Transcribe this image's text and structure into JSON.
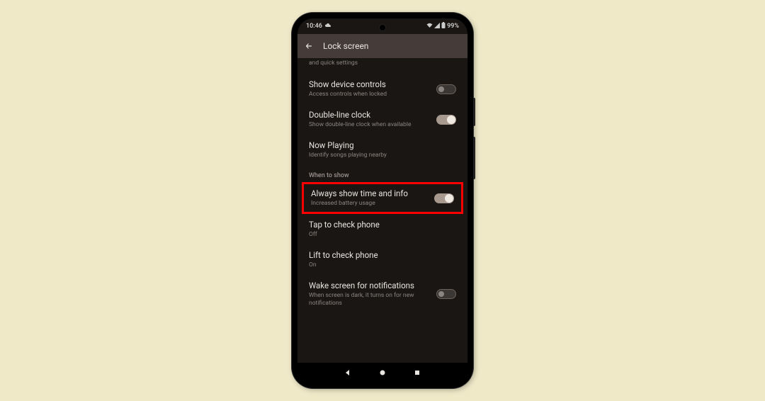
{
  "statusbar": {
    "time": "10:46",
    "battery": "99%"
  },
  "appbar": {
    "title": "Lock screen"
  },
  "partial_row": {
    "subtitle": "and quick settings"
  },
  "settings": [
    {
      "title": "Show device controls",
      "subtitle": "Access controls when locked",
      "switch": "off"
    },
    {
      "title": "Double-line clock",
      "subtitle": "Show double-line clock when available",
      "switch": "on"
    },
    {
      "title": "Now Playing",
      "subtitle": "Identify songs playing nearby"
    }
  ],
  "section_header": "When to show",
  "highlighted": {
    "title": "Always show time and info",
    "subtitle": "Increased battery usage",
    "switch": "on"
  },
  "settings2": [
    {
      "title": "Tap to check phone",
      "subtitle": "Off"
    },
    {
      "title": "Lift to check phone",
      "subtitle": "On"
    },
    {
      "title": "Wake screen for notifications",
      "subtitle": "When screen is dark, it turns on for new notifications",
      "switch": "off"
    }
  ]
}
